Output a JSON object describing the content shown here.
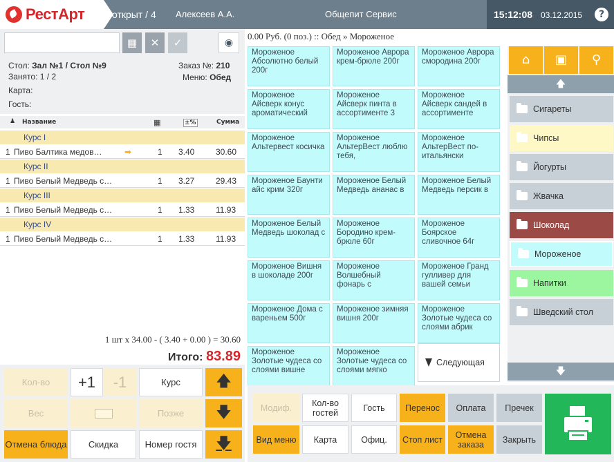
{
  "header": {
    "logo": "РестАрт",
    "status": "открыт / 4",
    "waiter": "Алексеев А.А.",
    "company": "Общепит Сервис",
    "time": "15:12:08",
    "date": "03.12.2015",
    "help": "?"
  },
  "order_info": {
    "table_label": "Стол:",
    "table_value": "Зал №1 / Стол №9",
    "busy_label": "Занято:",
    "busy_value": "1 / 2",
    "card_label": "Карта:",
    "guest_label": "Гость:",
    "order_label": "Заказ №:",
    "order_value": "210",
    "menu_label": "Меню:",
    "menu_value": "Обед"
  },
  "table": {
    "headers": {
      "name": "Название",
      "sum": "Сумма",
      "discount": "±%"
    },
    "rows": [
      {
        "type": "course",
        "label": "Курс I"
      },
      {
        "type": "item",
        "num": "1",
        "name": "Пиво Балтика медов…",
        "qty": "1",
        "price": "3.40",
        "sum": "30.60"
      },
      {
        "type": "course",
        "label": "Курс II"
      },
      {
        "type": "item",
        "num": "1",
        "name": "Пиво Белый Медведь с…",
        "qty": "1",
        "price": "3.27",
        "sum": "29.43"
      },
      {
        "type": "course",
        "label": "Курс III"
      },
      {
        "type": "item",
        "num": "1",
        "name": "Пиво Белый Медведь с…",
        "qty": "1",
        "price": "1.33",
        "sum": "11.93"
      },
      {
        "type": "course",
        "label": "Курс IV"
      },
      {
        "type": "item",
        "num": "1",
        "name": "Пиво Белый Медведь с…",
        "qty": "1",
        "price": "1.33",
        "sum": "11.93"
      }
    ]
  },
  "calc_line": "1 шт x 34.00 - ( 3.40 + 0.00 ) = 30.60",
  "total": {
    "label": "Итого:",
    "value": "83.89"
  },
  "left_buttons": {
    "qty": "Кол-во",
    "plus": "+1",
    "minus": "-1",
    "course": "Курс",
    "weight": "Вес",
    "later": "Позже",
    "cancel_dish": "Отмена блюда",
    "discount": "Скидка",
    "guest_number": "Номер гостя"
  },
  "breadcrumb": "0.00 Руб. (0 поз.)  ::  Обед » Мороженое",
  "products": [
    "Мороженое Абсолютно белый 200г",
    "Мороженое Аврора крем-брюле 200г",
    "Мороженое Аврора смородина 200г",
    "Мороженое Айсверк конус ароматический",
    "Мороженое Айсверк пинта в ассортименте 3",
    "Мороженое Айсверк сандей в ассортименте",
    "Мороженое Альтервест косичка",
    "Мороженое АльтерВест люблю тебя,",
    "Мороженое АльтерВест по-итальянски",
    "Мороженое Баунти айс крим 320г",
    "Мороженое Белый Медведь ананас в",
    "Мороженое Белый Медведь персик в",
    "Мороженое Белый Медведь шоколад с",
    "Мороженое Бородино крем-брюле 60г",
    "Мороженое Боярское сливочное 64г",
    "Мороженое Вишня в шоколаде 200г",
    "Мороженое Волшебный фонарь с",
    "Мороженое Гранд гулливер для вашей семьи",
    "Мороженое Дома с вареньем 500г",
    "Мороженое зимняя вишня 200г",
    "Мороженое Золотые чудеса со слоями абрик",
    "Мороженое Золотые чудеса со слоями вишне",
    "Мороженое Золотые чудеса со слоями мягко"
  ],
  "next_label": "Следующая",
  "categories": [
    {
      "name": "Сигареты",
      "bg": "#c6d0d6"
    },
    {
      "name": "Чипсы",
      "bg": "#fdf8c5"
    },
    {
      "name": "Йогурты",
      "bg": "#c6d0d6"
    },
    {
      "name": "Жвачка",
      "bg": "#c6d0d6"
    },
    {
      "name": "Шоколад",
      "bg": "#9b4a46"
    },
    {
      "name": "Мороженое",
      "bg": "#c2fbfb"
    },
    {
      "name": "Напитки",
      "bg": "#9cf59f"
    },
    {
      "name": "Шведский стол",
      "bg": "#c6d0d6"
    }
  ],
  "actions": {
    "modif": "Модиф.",
    "guests_count": "Кол-во гостей",
    "guest": "Гость",
    "transfer": "Перенос",
    "payment": "Оплата",
    "precheck": "Пречек",
    "view_menu": "Вид меню",
    "card": "Карта",
    "waiter": "Офиц.",
    "stop_list": "Стоп лист",
    "cancel_order": "Отмена заказа",
    "close": "Закрыть"
  },
  "colors": {
    "accent": "#f7b21b",
    "brand_red": "#d6262b",
    "tile": "#c2fbfb",
    "header": "#6d7e8c",
    "print": "#22b85a"
  }
}
